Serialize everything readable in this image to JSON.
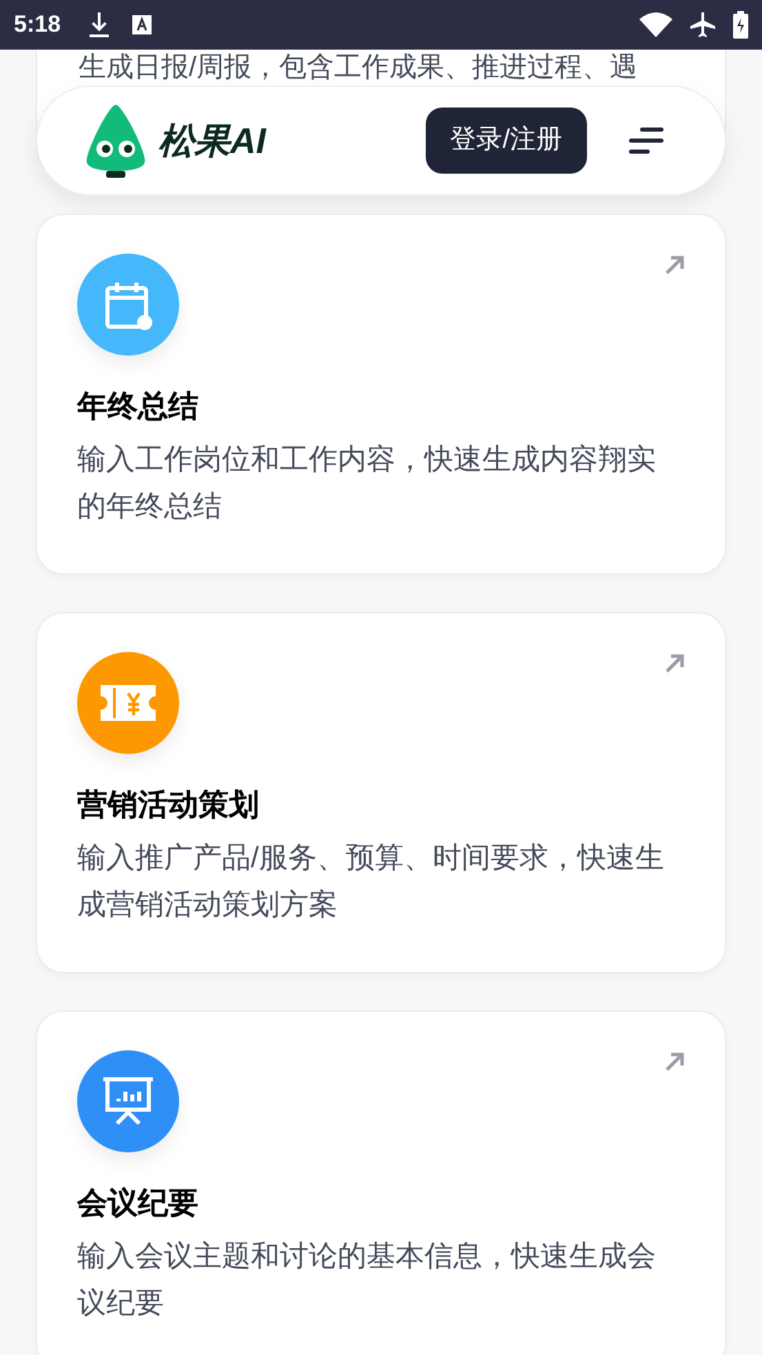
{
  "status_bar": {
    "time": "5:18"
  },
  "header": {
    "brand": "松果AI",
    "login_button": "登录/注册"
  },
  "previous_card": {
    "description": "生成日报/周报，包含工作成果、推进过程、遇"
  },
  "cards": [
    {
      "kind": "calendar",
      "color": "#45b7fb",
      "title": "年终总结",
      "description": "输入工作岗位和工作内容，快速生成内容翔实的年终总结"
    },
    {
      "kind": "ticket",
      "color": "#fe9800",
      "title": "营销活动策划",
      "description": "输入推广产品/服务、预算、时间要求，快速生成营销活动策划方案"
    },
    {
      "kind": "presentation",
      "color": "#2e8ff7",
      "title": "会议纪要",
      "description": "输入会议主题和讨论的基本信息，快速生成会议纪要"
    }
  ]
}
